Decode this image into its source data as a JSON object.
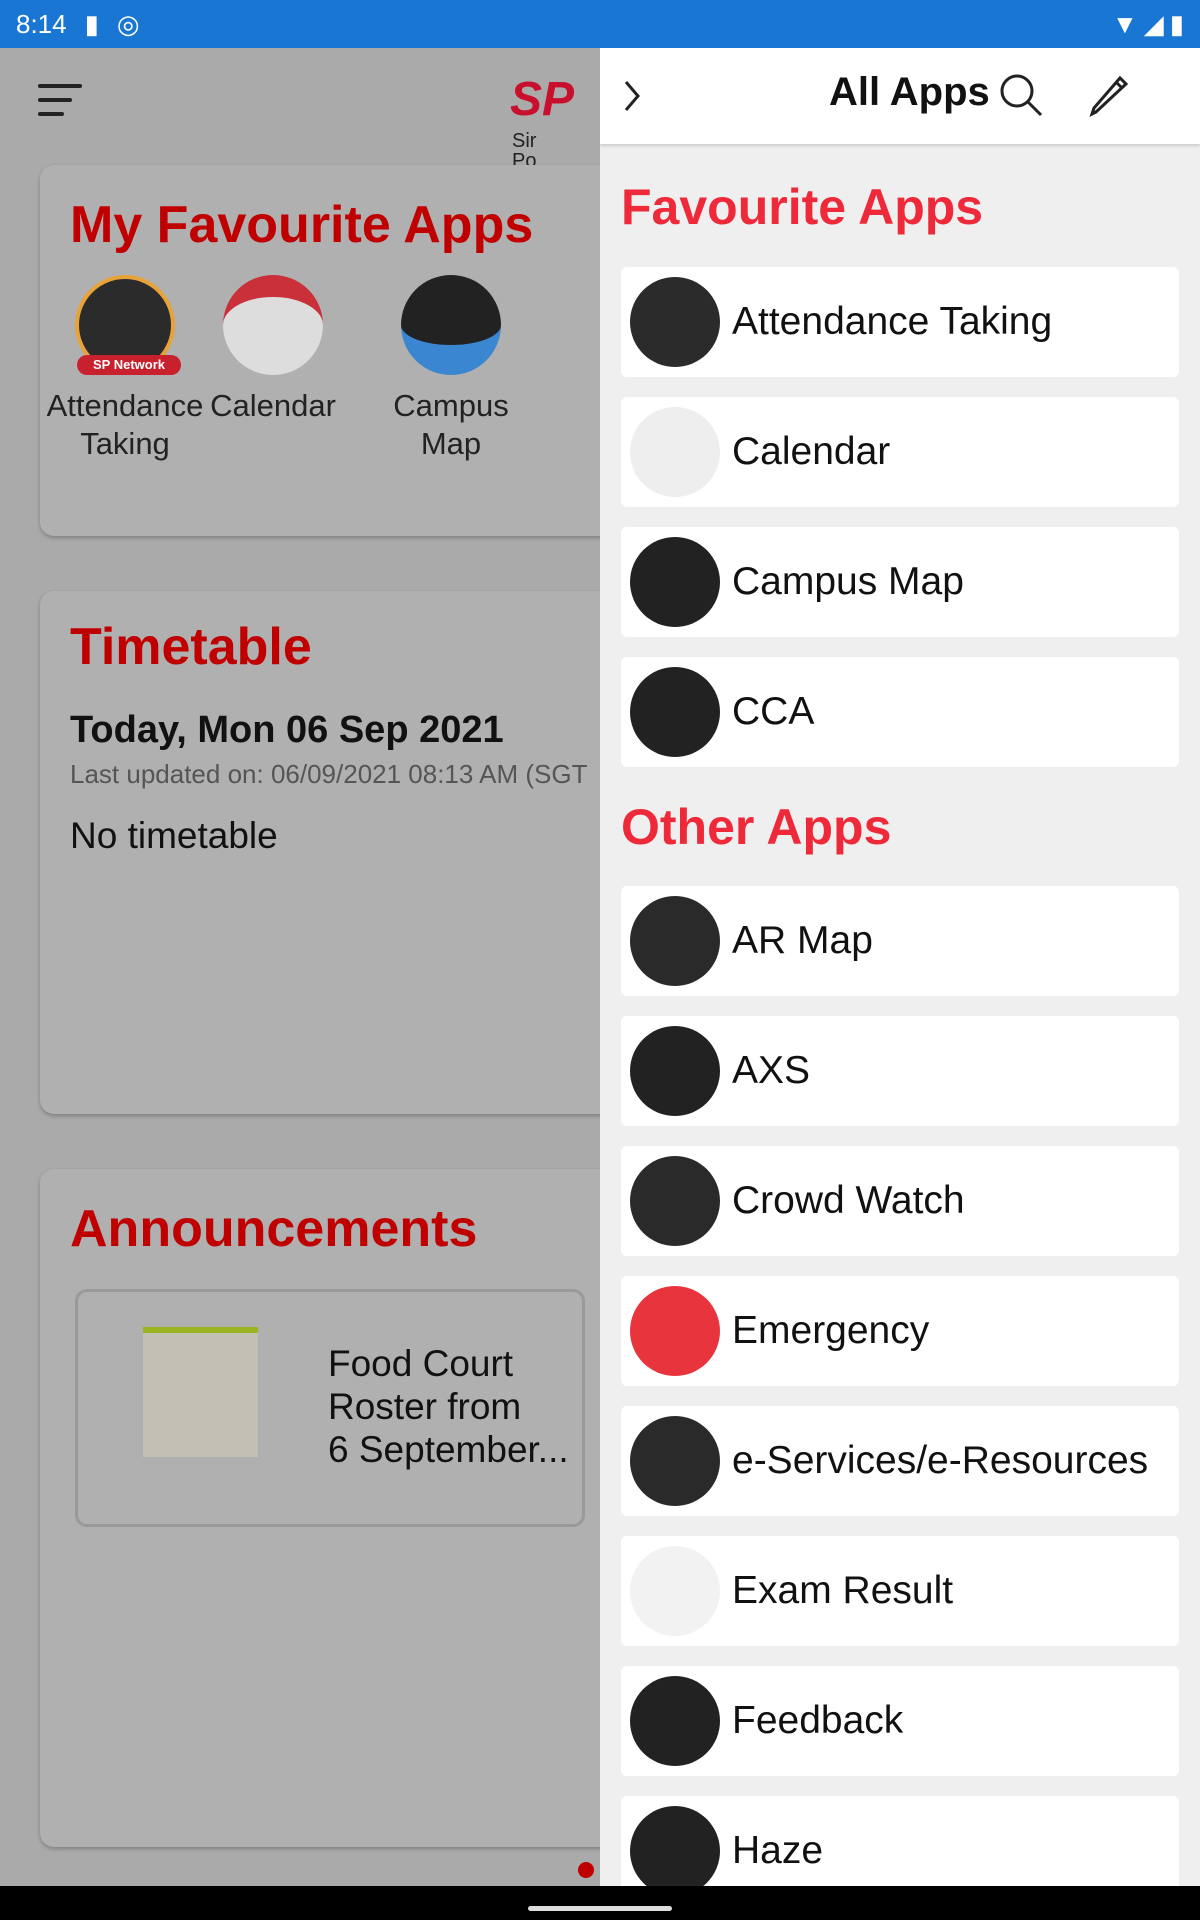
{
  "status_bar": {
    "time": "8:14"
  },
  "home": {
    "logo": "SP",
    "logo_sub1": "Sir",
    "logo_sub2": "Po",
    "favourites": {
      "title": "My Favourite Apps",
      "apps": [
        {
          "line1": "Attendance",
          "line2": "Taking",
          "badge": "SP Network"
        },
        {
          "line1": "Calendar",
          "line2": ""
        },
        {
          "line1": "Campus",
          "line2": "Map"
        }
      ]
    },
    "timetable": {
      "title": "Timetable",
      "date": "Today, Mon 06 Sep 2021",
      "updated": "Last updated on: 06/09/2021 08:13 AM (SGT",
      "empty": "No timetable"
    },
    "announcements": {
      "title": "Announcements",
      "items": [
        {
          "line1": "Food Court",
          "line2": "Roster from",
          "line3": "6 September..."
        }
      ]
    }
  },
  "drawer": {
    "title": "All Apps",
    "favourite_title": "Favourite Apps",
    "favourites": [
      {
        "label": "Attendance Taking",
        "icon": "attendance-icon",
        "color": "#2b2b2b"
      },
      {
        "label": "Calendar",
        "icon": "calendar-icon",
        "color": "#eeeeee"
      },
      {
        "label": "Campus Map",
        "icon": "map-icon",
        "color": "#222222"
      },
      {
        "label": "CCA",
        "icon": "medal-icon",
        "color": "#222222"
      }
    ],
    "other_title": "Other Apps",
    "others": [
      {
        "label": "AR Map",
        "icon": "ar-map-icon",
        "color": "#2a2a2a"
      },
      {
        "label": "AXS",
        "icon": "axs-icon",
        "color": "#222222"
      },
      {
        "label": "Crowd Watch",
        "icon": "crowd-icon",
        "color": "#2a2a2a"
      },
      {
        "label": "Emergency",
        "icon": "emergency-icon",
        "color": "#e8343c"
      },
      {
        "label": "e-Services/e-Resources",
        "icon": "eservices-icon",
        "color": "#2a2a2a"
      },
      {
        "label": "Exam Result",
        "icon": "exam-icon",
        "color": "#f2f2f2"
      },
      {
        "label": "Feedback",
        "icon": "feedback-icon",
        "color": "#222222"
      },
      {
        "label": "Haze",
        "icon": "haze-icon",
        "color": "#222222"
      }
    ]
  },
  "colors": {
    "accent": "#ee2a3a",
    "home_title": "#c00000",
    "status_bar": "#1976d2"
  }
}
